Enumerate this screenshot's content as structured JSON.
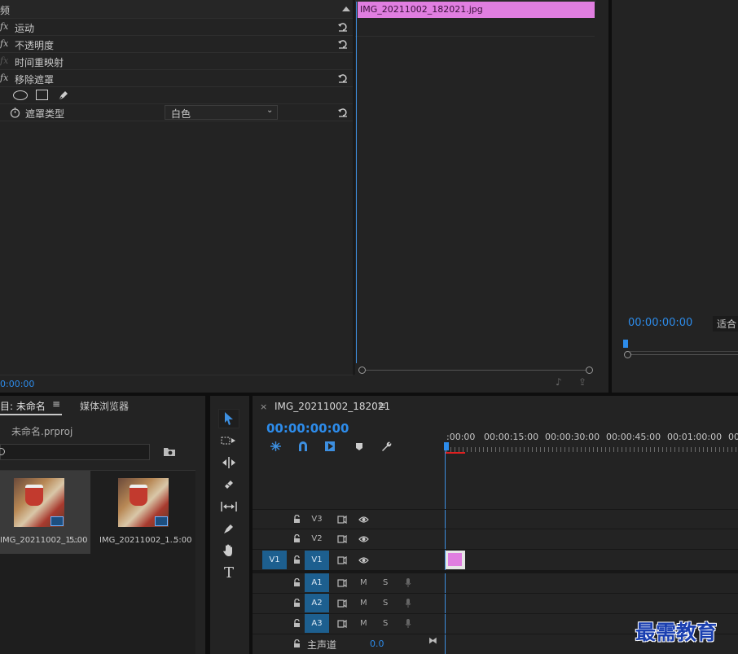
{
  "effect_controls": {
    "header_label": "频",
    "clip_name": "IMG_20211002_182021.jpg",
    "effects": [
      {
        "label": "运动",
        "fx": "fx"
      },
      {
        "label": "不透明度",
        "fx": "fx"
      },
      {
        "label": "时间重映射",
        "fx": "fx"
      },
      {
        "label": "移除遮罩",
        "fx": "fx"
      }
    ],
    "matte_type_label": "遮罩类型",
    "matte_type_value": "白色",
    "timecode": "0:00:00"
  },
  "program_monitor": {
    "timecode": "00:00:00:00",
    "fit_label": "适合"
  },
  "project_panel": {
    "tab_project": "目: 未命名",
    "tab_media_browser": "媒体浏览器",
    "project_file": "未命名.prproj",
    "items": [
      {
        "name": "IMG_20211002_1...",
        "duration": "5:00"
      },
      {
        "name": "IMG_20211002_1...",
        "duration": "5:00"
      }
    ]
  },
  "timeline": {
    "close_symbol": "×",
    "sequence_name": "IMG_20211002_182021",
    "menu_symbol": "≡",
    "timecode": "00:00:00:00",
    "ruler_labels": [
      ":00:00",
      "00:00:15:00",
      "00:00:30:00",
      "00:00:45:00",
      "00:01:00:00",
      "00"
    ],
    "video_tracks": [
      "V3",
      "V2",
      "V1"
    ],
    "source_patch": "V1",
    "audio_tracks": [
      "A1",
      "A2",
      "A3"
    ],
    "mute_label": "M",
    "solo_label": "S",
    "master_label": "主声道",
    "master_value": "0.0"
  },
  "watermark": "最需教育",
  "colors": {
    "accent_blue": "#2d8ceb",
    "clip_pink": "#e07ee0",
    "panel_bg": "#232323",
    "track_target": "#1d5f8f"
  }
}
